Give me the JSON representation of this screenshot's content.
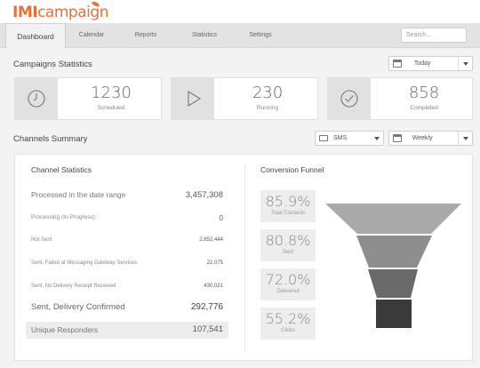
{
  "header": {
    "logo_bold": "IMI",
    "logo_rest": "campaign",
    "tabs": [
      {
        "label": "Dashboard"
      },
      {
        "label": "Calendar"
      },
      {
        "label": "Reports"
      },
      {
        "label": "Statistics"
      },
      {
        "label": "Settings"
      }
    ],
    "search_placeholder": "Search..."
  },
  "campaigns": {
    "title": "Campaigns Statistics",
    "range_select": "Today",
    "cards": [
      {
        "value": "1230",
        "label": "Scheduled",
        "icon": "clock-icon"
      },
      {
        "value": "230",
        "label": "Running",
        "icon": "play-icon"
      },
      {
        "value": "858",
        "label": "Completed",
        "icon": "check-circle-icon"
      }
    ]
  },
  "channels": {
    "title": "Channels Summary",
    "channel_select": "SMS",
    "period_select": "Weekly",
    "stats_title": "Channel Statistics",
    "rows": [
      {
        "label": "Processed in the date range",
        "value": "3,457,308"
      },
      {
        "label": "Processing (In-Progress)",
        "value": "0"
      },
      {
        "label": "Not Sent",
        "value": "2,652,444"
      },
      {
        "label": "Sent, Failed at Messaging Gateway Services",
        "value": "22,075"
      },
      {
        "label": "Sent, No Delivery Receipt Received",
        "value": "430,021"
      },
      {
        "label": "Sent, Delivery Confirmed",
        "value": "292,776"
      },
      {
        "label": "Unique Responders",
        "value": "107,541"
      }
    ],
    "funnel_title": "Conversion Funnel",
    "funnel": [
      {
        "percent": "85.9%",
        "label": "Total Contacts"
      },
      {
        "percent": "80.8%",
        "label": "Sent"
      },
      {
        "percent": "72.0%",
        "label": "Delivered"
      },
      {
        "percent": "55.2%",
        "label": "Clicks"
      }
    ]
  },
  "colors": {
    "brand": "#e8713a",
    "funnel": [
      "#a9a9a9",
      "#8e8e8e",
      "#6a6a6a",
      "#3a3a3a"
    ]
  }
}
